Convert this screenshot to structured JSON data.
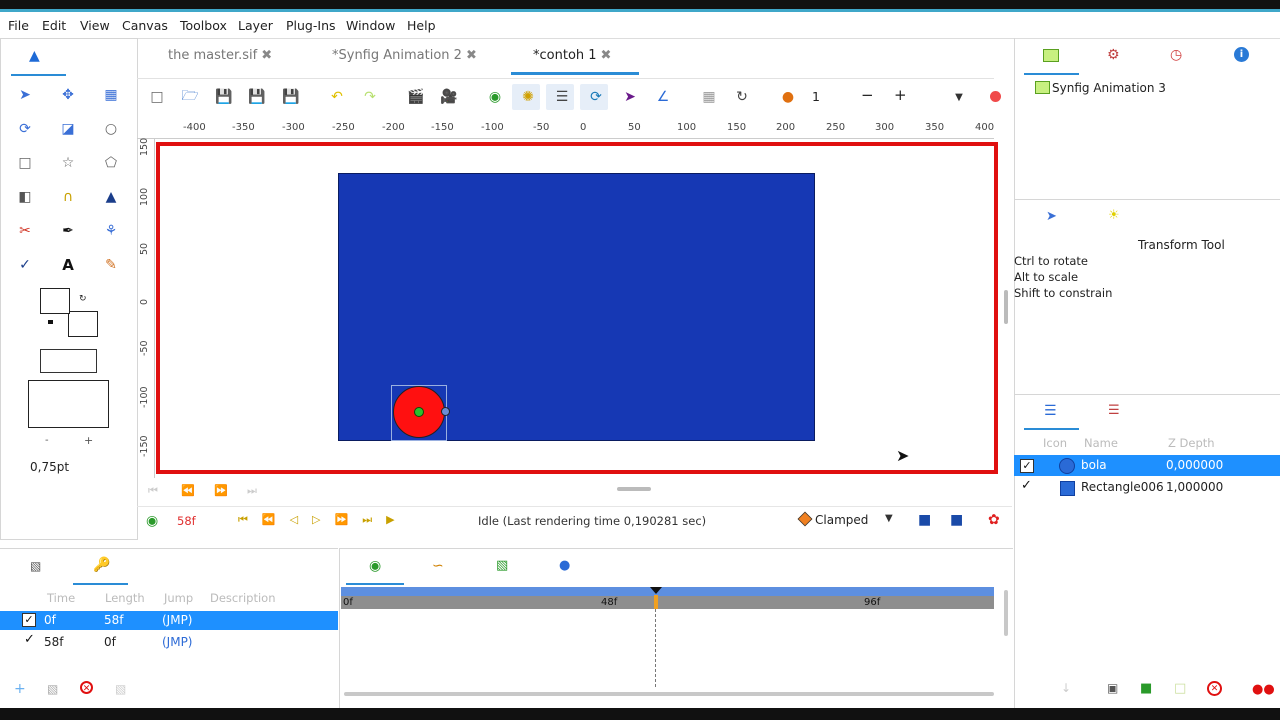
{
  "menu": [
    "File",
    "Edit",
    "View",
    "Canvas",
    "Toolbox",
    "Layer",
    "Plug-Ins",
    "Window",
    "Help"
  ],
  "tabs": [
    {
      "label": "the master.sif",
      "active": false
    },
    {
      "label": "*Synfig Animation 2",
      "active": false
    },
    {
      "label": "*contoh 1",
      "active": true
    }
  ],
  "toolbar": {
    "frame_value": "1",
    "minus": "−",
    "plus": "+"
  },
  "ruler_h": [
    "-400",
    "-350",
    "-300",
    "-250",
    "-200",
    "-150",
    "-100",
    "-50",
    "0",
    "50",
    "100",
    "150",
    "200",
    "250",
    "300",
    "350",
    "400"
  ],
  "ruler_v": [
    "150",
    "100",
    "50",
    "0",
    "-50",
    "-100",
    "-150"
  ],
  "toolbox": {
    "width_value": "0,75pt",
    "minus": "-",
    "plus": "+"
  },
  "status": {
    "current_frame": "58f",
    "render_text": "Idle (Last rendering time 0,190281 sec)",
    "interpolation": "Clamped"
  },
  "canvas_browser": {
    "root": "Synfig Animation 3"
  },
  "tool_options": {
    "title": "Transform Tool",
    "lines": [
      "Ctrl to rotate",
      "Alt to scale",
      "Shift to constrain"
    ]
  },
  "layers": {
    "headers": [
      "Icon",
      "Name",
      "Z Depth"
    ],
    "rows": [
      {
        "name": "bola",
        "z": "0,000000",
        "selected": true
      },
      {
        "name": "Rectangle006",
        "z": "1,000000",
        "selected": false
      }
    ]
  },
  "keyframes": {
    "headers": [
      "Time",
      "Length",
      "Jump",
      "Description"
    ],
    "rows": [
      {
        "time": "0f",
        "length": "58f",
        "jump": "(JMP)",
        "selected": true
      },
      {
        "time": "58f",
        "length": "0f",
        "jump": "(JMP)",
        "selected": false
      }
    ]
  },
  "timeline": {
    "marks": [
      "0f",
      "48f",
      "96f"
    ]
  },
  "colors": {
    "canvas_bg": "#1638b4",
    "frame_red": "#e01010",
    "ball_red": "#ff1010",
    "selection_blue": "#1e90ff",
    "timeline_blue": "#5d8fe0"
  }
}
